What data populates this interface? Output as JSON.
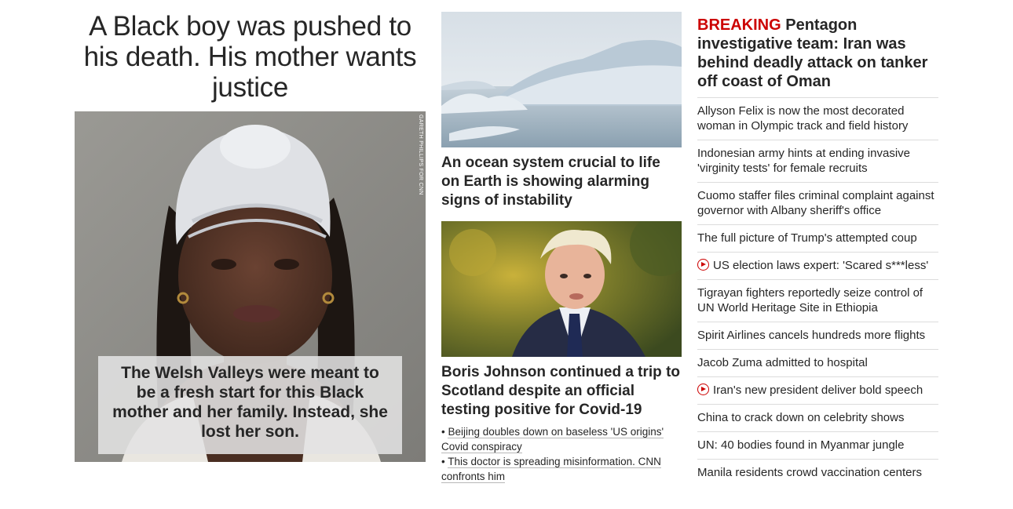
{
  "lead_story": {
    "headline": "A Black boy was pushed to his death. His mother wants justice",
    "photo_credit": "GARETH PHILLIPS FOR CNN",
    "caption": "The Welsh Valleys were meant to be a fresh start for this Black mother and her family. Instead, she lost her son."
  },
  "middle_column": {
    "story1": {
      "headline": "An ocean system crucial to life on Earth is showing alarming signs of instability"
    },
    "story2": {
      "headline": "Boris Johnson continued a trip to Scotland despite an official testing positive for Covid-19",
      "related": [
        "Beijing doubles down on baseless 'US origins' Covid conspiracy",
        "This doctor is spreading misinformation. CNN confronts him"
      ]
    }
  },
  "right_column": {
    "breaking": {
      "tag": "BREAKING",
      "headline": "Pentagon investigative team: Iran was behind deadly attack on tanker off coast of Oman"
    },
    "items": [
      {
        "text": "Allyson Felix is now the most decorated woman in Olympic track and field history",
        "video": false
      },
      {
        "text": "Indonesian army hints at ending invasive 'virginity tests' for female recruits",
        "video": false
      },
      {
        "text": "Cuomo staffer files criminal complaint against governor with Albany sheriff's office",
        "video": false
      },
      {
        "text": "The full picture of Trump's attempted coup",
        "video": false
      },
      {
        "text": "US election laws expert: 'Scared s***less'",
        "video": true
      },
      {
        "text": "Tigrayan fighters reportedly seize control of UN World Heritage Site in Ethiopia",
        "video": false
      },
      {
        "text": "Spirit Airlines cancels hundreds more flights",
        "video": false
      },
      {
        "text": "Jacob Zuma admitted to hospital",
        "video": false
      },
      {
        "text": "Iran's new president deliver bold speech",
        "video": true
      },
      {
        "text": "China to crack down on celebrity shows",
        "video": false
      },
      {
        "text": "UN: 40 bodies found in Myanmar jungle",
        "video": false
      },
      {
        "text": "Manila residents crowd vaccination centers",
        "video": false
      }
    ]
  },
  "colors": {
    "breaking_red": "#cc0000",
    "text": "#262626",
    "divider": "#dcdcdc"
  }
}
